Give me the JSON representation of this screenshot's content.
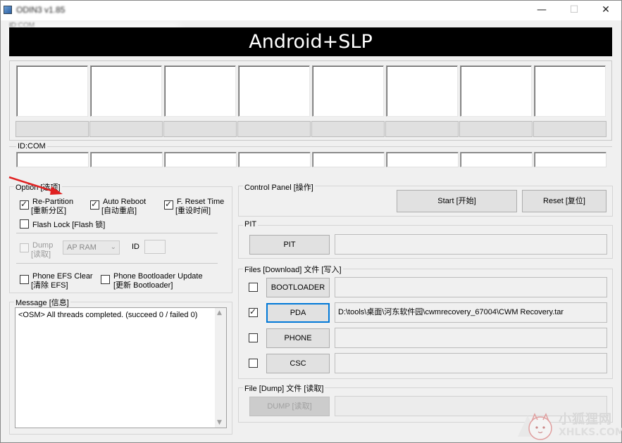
{
  "window": {
    "title": "ODIN3 v1.85",
    "id_label": "ID:COM",
    "controls": {
      "minimize": "—",
      "maximize": "☐",
      "close": "✕"
    }
  },
  "banner": {
    "text": "Android+SLP"
  },
  "ports": {
    "idcom_label": "ID:COM"
  },
  "option": {
    "label": "Option [选项]",
    "repartition_line1": "Re-Partition",
    "repartition_line2": "[重新分区]",
    "repartition_checked": true,
    "autoreboot_line1": "Auto Reboot",
    "autoreboot_line2": "[自动重启]",
    "autoreboot_checked": true,
    "freset_line1": "F. Reset Time",
    "freset_line2": "[重设时间]",
    "freset_checked": true,
    "flashlock_label": "Flash Lock [Flash 锁]",
    "flashlock_checked": false,
    "dump_line1": "Dump",
    "dump_line2": "[读取]",
    "dump_select_value": "AP RAM",
    "id_label": "ID",
    "efs_line1": "Phone EFS Clear",
    "efs_line2": "[清除 EFS]",
    "bootloader_update_line1": "Phone Bootloader Update",
    "bootloader_update_line2": "[更新 Bootloader]"
  },
  "message": {
    "label": "Message [信息]",
    "text": "<OSM> All threads completed. (succeed 0 / failed 0)"
  },
  "control_panel": {
    "label": "Control Panel [操作]",
    "start_label": "Start [开始]",
    "reset_label": "Reset [复位]"
  },
  "pit": {
    "label": "PIT",
    "button_label": "PIT",
    "path": ""
  },
  "files": {
    "label": "Files [Download] 文件 [写入]",
    "rows": [
      {
        "button_label": "BOOTLOADER",
        "checked": false,
        "path": ""
      },
      {
        "button_label": "PDA",
        "checked": true,
        "path": "D:\\tools\\桌面\\河东软件园\\cwmrecovery_67004\\CWM Recovery.tar"
      },
      {
        "button_label": "PHONE",
        "checked": false,
        "path": ""
      },
      {
        "button_label": "CSC",
        "checked": false,
        "path": ""
      }
    ]
  },
  "file_dump": {
    "label": "File [Dump] 文件 [读取]",
    "button_label": "DUMP [读取]",
    "path": ""
  },
  "watermark": {
    "line1": "小狐狸网",
    "line2": "XHLKS.COM"
  },
  "colors": {
    "banner_bg": "#000000",
    "focus_border": "#0078d7",
    "annotation_arrow": "#e02020"
  }
}
